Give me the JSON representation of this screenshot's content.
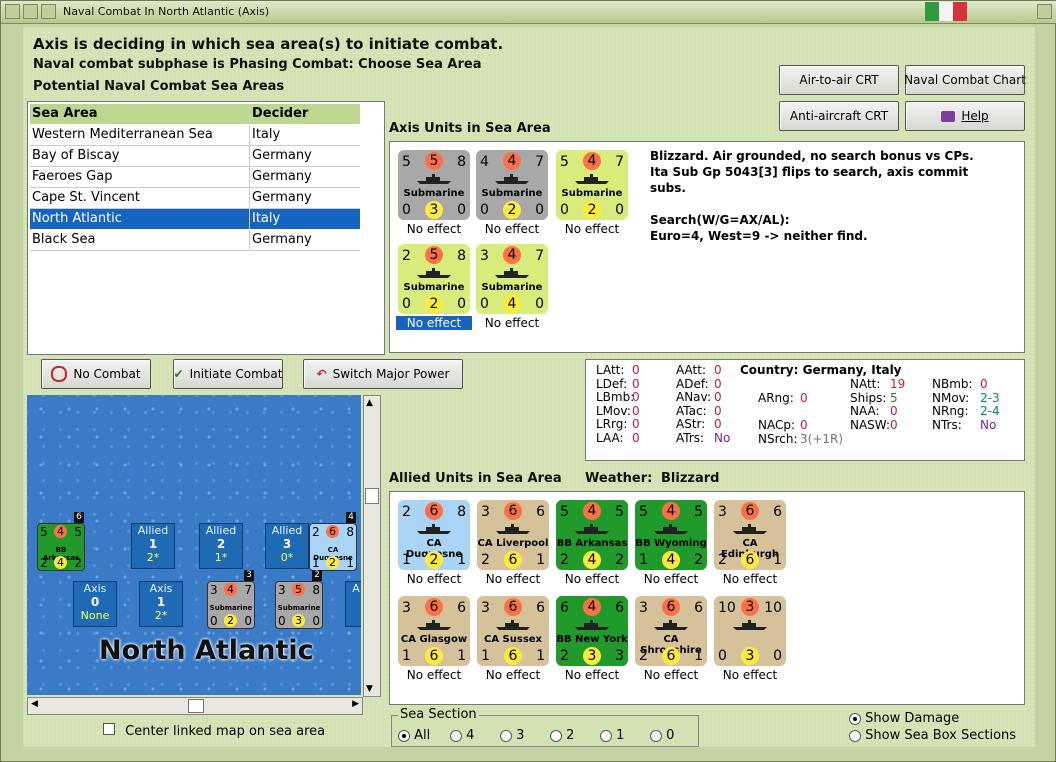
{
  "window": {
    "title": "Naval Combat In North Atlantic (Axis)"
  },
  "header": {
    "line1": "Axis is deciding in which sea area(s) to initiate combat.",
    "line2": "Naval combat subphase is Phasing Combat: Choose Sea Area",
    "line3": "Potential Naval Combat Sea Areas"
  },
  "buttons": {
    "air_to_air": "Air-to-air CRT",
    "naval_chart": "Naval Combat Chart",
    "anti_aircraft": "Anti-aircraft CRT",
    "help": "Help",
    "no_combat": "No Combat",
    "initiate_combat": "Initiate Combat",
    "switch_major": "Switch Major Power"
  },
  "sea_table": {
    "headers": [
      "Sea Area",
      "Decider"
    ],
    "rows": [
      [
        "Western Mediterranean Sea",
        "Italy"
      ],
      [
        "Bay of Biscay",
        "Germany"
      ],
      [
        "Faeroes Gap",
        "Germany"
      ],
      [
        "Cape St. Vincent",
        "Germany"
      ],
      [
        "North Atlantic",
        "Italy"
      ],
      [
        "Black Sea",
        "Germany"
      ]
    ],
    "selected_index": 4
  },
  "axis_units": {
    "label": "Axis Units in Sea Area",
    "units": [
      {
        "name": "Submarine",
        "tl": "5",
        "tc": "5",
        "tr": "8",
        "bl": "0",
        "bc": "3",
        "br": "0",
        "effect": "No effect",
        "color": "#a8a8a8"
      },
      {
        "name": "Submarine",
        "tl": "4",
        "tc": "4",
        "tr": "7",
        "bl": "0",
        "bc": "2",
        "br": "0",
        "effect": "No effect",
        "color": "#a8a8a8"
      },
      {
        "name": "Submarine",
        "tl": "5",
        "tc": "4",
        "tr": "7",
        "bl": "0",
        "bc": "2",
        "br": "0",
        "effect": "No effect",
        "color": "#d8ec7c"
      },
      {
        "name": "Submarine",
        "tl": "2",
        "tc": "5",
        "tr": "8",
        "bl": "0",
        "bc": "2",
        "br": "0",
        "effect": "No effect",
        "color": "#d8ec7c"
      },
      {
        "name": "Submarine",
        "tl": "3",
        "tc": "4",
        "tr": "7",
        "bl": "0",
        "bc": "4",
        "br": "0",
        "effect": "No effect",
        "color": "#d8ec7c"
      }
    ],
    "notes": [
      "Blizzard.  Air grounded, no search bonus vs CPs.",
      "Ita Sub Gp 5043[3] flips to search, axis commit",
      "subs.",
      "",
      "Search(W/G=AX/AL):",
      "Euro=4, West=9 -> neither find."
    ]
  },
  "stats": {
    "country": "Country: Germany, Italy",
    "col1": [
      [
        "LAtt:",
        "0"
      ],
      [
        "LDef:",
        "0"
      ],
      [
        "LBmb:",
        "0"
      ],
      [
        "LMov:",
        "0"
      ],
      [
        "LRrg:",
        "0"
      ],
      [
        "LAA:",
        "0"
      ]
    ],
    "col2": [
      [
        "AAtt:",
        "0"
      ],
      [
        "ADef:",
        "0"
      ],
      [
        "ANav:",
        "0"
      ],
      [
        "ATac:",
        "0"
      ],
      [
        "AStr:",
        "0"
      ],
      [
        "ATrs:",
        "No"
      ]
    ],
    "col3": [
      [
        "ARng:",
        "0"
      ],
      [
        "NACp:",
        "0"
      ],
      [
        "NSrch:",
        "3(+1R)"
      ]
    ],
    "col4": [
      [
        "NAtt:",
        "19"
      ],
      [
        "Ships:",
        "5"
      ],
      [
        "NAA:",
        "0"
      ],
      [
        "NASW:",
        "0"
      ]
    ],
    "col5": [
      [
        "NBmb:",
        "0"
      ],
      [
        "NMov:",
        "2-3"
      ],
      [
        "NRng:",
        "2-4"
      ],
      [
        "NTrs:",
        "No"
      ]
    ]
  },
  "allied_units": {
    "label": "Allied Units in Sea Area",
    "weather_label": "Weather:",
    "weather": "Blizzard",
    "units": [
      {
        "name": "CA Duquesne",
        "tl": "2",
        "tc": "6",
        "tr": "8",
        "bl": "1",
        "bc": "2",
        "br": "1",
        "effect": "No effect",
        "color": "#a9d4f5"
      },
      {
        "name": "CA Liverpool",
        "tl": "3",
        "tc": "6",
        "tr": "6",
        "bl": "2",
        "bc": "6",
        "br": "1",
        "effect": "No effect",
        "color": "#d6c29a"
      },
      {
        "name": "BB Arkansas",
        "tl": "5",
        "tc": "4",
        "tr": "5",
        "bl": "2",
        "bc": "4",
        "br": "2",
        "effect": "No effect",
        "color": "#1f9a2b"
      },
      {
        "name": "BB Wyoming",
        "tl": "5",
        "tc": "4",
        "tr": "5",
        "bl": "1",
        "bc": "4",
        "br": "2",
        "effect": "No effect",
        "color": "#1f9a2b"
      },
      {
        "name": "CA Edinburgh",
        "tl": "3",
        "tc": "6",
        "tr": "6",
        "bl": "2",
        "bc": "6",
        "br": "1",
        "effect": "No effect",
        "color": "#d6c29a"
      },
      {
        "name": "CA Glasgow",
        "tl": "3",
        "tc": "6",
        "tr": "6",
        "bl": "1",
        "bc": "6",
        "br": "1",
        "effect": "No effect",
        "color": "#d6c29a"
      },
      {
        "name": "CA Sussex",
        "tl": "3",
        "tc": "6",
        "tr": "6",
        "bl": "1",
        "bc": "6",
        "br": "1",
        "effect": "No effect",
        "color": "#d6c29a"
      },
      {
        "name": "BB New York",
        "tl": "6",
        "tc": "4",
        "tr": "6",
        "bl": "2",
        "bc": "3",
        "br": "3",
        "effect": "No effect",
        "color": "#1f9a2b"
      },
      {
        "name": "CA Shropshire",
        "tl": "3",
        "tc": "6",
        "tr": "6",
        "bl": "2",
        "bc": "6",
        "br": "1",
        "effect": "No effect",
        "color": "#d6c29a"
      },
      {
        "name": "",
        "tl": "10",
        "tc": "3",
        "tr": "10",
        "bl": "0",
        "bc": "3",
        "br": "0",
        "effect": "No effect",
        "color": "#d6c29a"
      }
    ]
  },
  "map": {
    "label": "North Atlantic",
    "boxes_top": [
      {
        "side": "Allied",
        "num": "1",
        "val": "2*"
      },
      {
        "side": "Allied",
        "num": "2",
        "val": "1*"
      },
      {
        "side": "Allied",
        "num": "3",
        "val": "0*"
      }
    ],
    "boxes_bottom": [
      {
        "side": "Axis",
        "num": "0",
        "val": "None"
      },
      {
        "side": "Axis",
        "num": "1",
        "val": "2*"
      }
    ],
    "units": [
      {
        "name": "BB Arkansas",
        "tl": "5",
        "c1": "4",
        "tr": "5",
        "bl": "2",
        "c2": "4",
        "br": "2",
        "stack": "6"
      },
      {
        "name": "CA Duquesne",
        "tl": "2",
        "c1": "6",
        "tr": "8",
        "bl": "1",
        "c2": "2",
        "br": "1",
        "stack": "4"
      },
      {
        "name": "Submarine",
        "tl": "3",
        "c1": "4",
        "tr": "7",
        "bl": "0",
        "c2": "2",
        "br": "0",
        "stack": "3"
      },
      {
        "name": "Submarine",
        "tl": "3",
        "c1": "5",
        "tr": "8",
        "bl": "0",
        "c2": "3",
        "br": "0",
        "stack": "2"
      }
    ],
    "extra_box": "A"
  },
  "footer": {
    "center_map": "Center linked map on sea area",
    "sea_section": "Sea Section",
    "sections": [
      "All",
      "4",
      "3",
      "2",
      "1",
      "0"
    ],
    "show_damage": "Show Damage",
    "show_sections": "Show Sea Box Sections"
  }
}
